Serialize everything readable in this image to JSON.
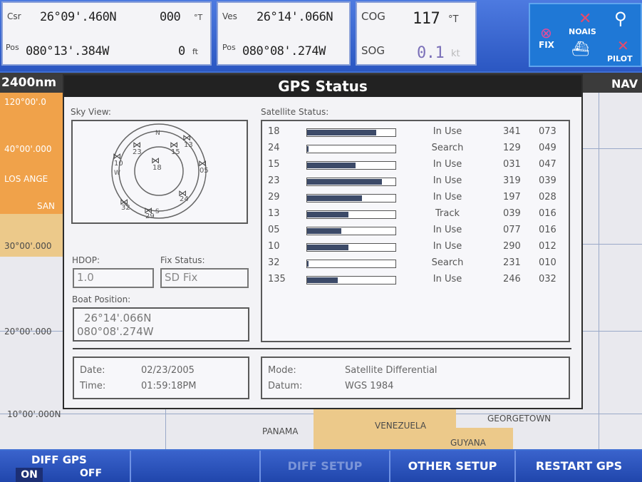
{
  "top": {
    "csr_label": "Csr",
    "csr_lat": "26°09'.460N",
    "csr_heading": "000",
    "csr_heading_unit": "°T",
    "pos_label": "Pos",
    "pos_lon": "080°13'.384W",
    "depth_value": "0",
    "depth_unit": "ft",
    "ves_label": "Ves",
    "ves_lat": "26°14'.066N",
    "ves_pos_label": "Pos",
    "ves_lon": "080°08'.274W",
    "cog_label": "COG",
    "cog_value": "117",
    "cog_unit": "°T",
    "sog_label": "SOG",
    "sog_value": "0.1",
    "sog_unit": "kt",
    "icons": {
      "fix_label": "FIX",
      "noais_label": "NOAIS",
      "pilot_label": "PILOT"
    }
  },
  "map": {
    "scale": "2400nm",
    "mode": "NAV",
    "lat_labels": [
      "120°00'.0",
      "40°00'.000",
      "30°00'.000",
      "20°00'.000",
      "10°00'.000N"
    ],
    "places": [
      "LOS ANGE",
      "SAN",
      "PANAMA",
      "VENEZUELA",
      "GUYANA",
      "GEORGETOWN"
    ]
  },
  "dialog": {
    "title": "GPS Status",
    "sky_view_label": "Sky View:",
    "sky_marks": {
      "north": "N",
      "west": "W",
      "south": "S"
    },
    "sky_sats": [
      "23",
      "15",
      "13",
      "10",
      "18",
      "05",
      "24",
      "32",
      "29"
    ],
    "satellite_status_label": "Satellite Status:",
    "satellites": [
      {
        "id": "18",
        "signal": 0.78,
        "status": "In Use",
        "azimuth": "341",
        "elevation": "073"
      },
      {
        "id": "24",
        "signal": 0.02,
        "status": "Search",
        "azimuth": "129",
        "elevation": "049"
      },
      {
        "id": "15",
        "signal": 0.55,
        "status": "In Use",
        "azimuth": "031",
        "elevation": "047"
      },
      {
        "id": "23",
        "signal": 0.85,
        "status": "In Use",
        "azimuth": "319",
        "elevation": "039"
      },
      {
        "id": "29",
        "signal": 0.62,
        "status": "In Use",
        "azimuth": "197",
        "elevation": "028"
      },
      {
        "id": "13",
        "signal": 0.47,
        "status": "Track",
        "azimuth": "039",
        "elevation": "016"
      },
      {
        "id": "05",
        "signal": 0.39,
        "status": "In Use",
        "azimuth": "077",
        "elevation": "016"
      },
      {
        "id": "10",
        "signal": 0.47,
        "status": "In Use",
        "azimuth": "290",
        "elevation": "012"
      },
      {
        "id": "32",
        "signal": 0.01,
        "status": "Search",
        "azimuth": "231",
        "elevation": "010"
      },
      {
        "id": "135",
        "signal": 0.35,
        "status": "In Use",
        "azimuth": "246",
        "elevation": "032"
      }
    ],
    "hdop_label": "HDOP:",
    "hdop_value": "1.0",
    "fix_status_label": "Fix Status:",
    "fix_status_value": "SD Fix",
    "boat_position_label": "Boat Position:",
    "boat_lat": "26°14'.066N",
    "boat_lon": "080°08'.274W",
    "date_label": "Date:",
    "date_value": "02/23/2005",
    "time_label": "Time:",
    "time_value": "01:59:18PM",
    "mode_label": "Mode:",
    "mode_value": "Satellite Differential",
    "datum_label": "Datum:",
    "datum_value": "WGS 1984"
  },
  "softkeys": {
    "diff_gps_label": "DIFF GPS",
    "diff_on": "ON",
    "diff_off": "OFF",
    "diff_setup": "DIFF SETUP",
    "other_setup": "OTHER SETUP",
    "restart_gps": "RESTART GPS"
  }
}
